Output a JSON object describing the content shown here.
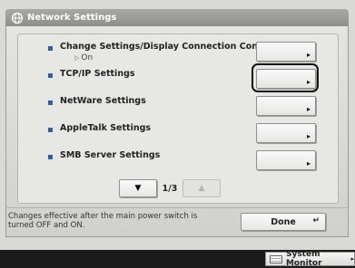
{
  "title": "Network Settings",
  "items": [
    {
      "label": "Change Settings/Display Connection Confirm.",
      "sub": "On"
    },
    {
      "label": "TCP/IP Settings"
    },
    {
      "label": "NetWare Settings"
    },
    {
      "label": "AppleTalk Settings"
    },
    {
      "label": "SMB Server Settings"
    }
  ],
  "selected_item": "TCP/IP Settings",
  "pager": {
    "page": "1/3"
  },
  "footer": {
    "note": "Changes effective after the main power switch is turned OFF and ON.",
    "done_label": "Done"
  },
  "status_bar": {
    "system_monitor_label": "System Monitor"
  },
  "colors": {
    "bullet": "#2a5fb0",
    "title_bar": "#9b9b98",
    "background": "#d9d9d6"
  },
  "icons": {
    "title": "network-globe-icon",
    "item_button": "arrow-right-icon",
    "page_down": "triangle-down-icon",
    "page_up": "triangle-up-icon",
    "done": "return-icon"
  }
}
